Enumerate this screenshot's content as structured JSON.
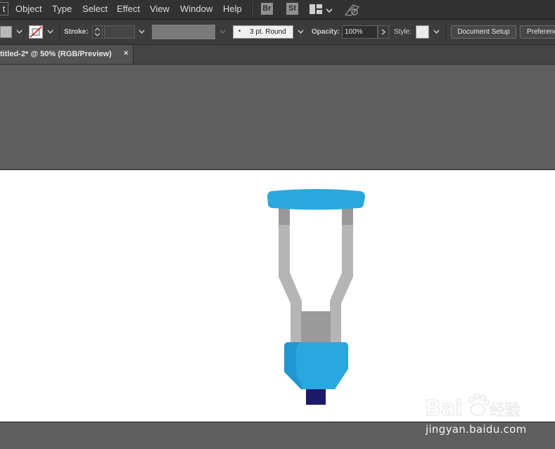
{
  "menu": {
    "items": [
      "Object",
      "Type",
      "Select",
      "Effect",
      "View",
      "Window",
      "Help"
    ],
    "first_fragment": "t",
    "bridge_label": "Br",
    "stock_label": "St"
  },
  "control_bar": {
    "stroke_label": "Stroke:",
    "brush_value": "3 pt. Round",
    "opacity_label": "Opacity:",
    "opacity_value": "100%",
    "style_label": "Style:",
    "document_setup_label": "Document Setup",
    "preferences_label": "Preferenc"
  },
  "tab": {
    "title": "titled-2* @ 50% (RGB/Preview)",
    "close": "×"
  },
  "colors": {
    "crutch_pad": "#29a8e0",
    "crutch_frame": "#b5b5b5",
    "crutch_frame_dark": "#999999",
    "crutch_grip": "#29a8e0",
    "crutch_grip_shade": "#2196cf",
    "crutch_tip": "#1d1a6b"
  },
  "watermark": {
    "brand": "Bai du 经验",
    "url": "jingyan.baidu.com"
  }
}
